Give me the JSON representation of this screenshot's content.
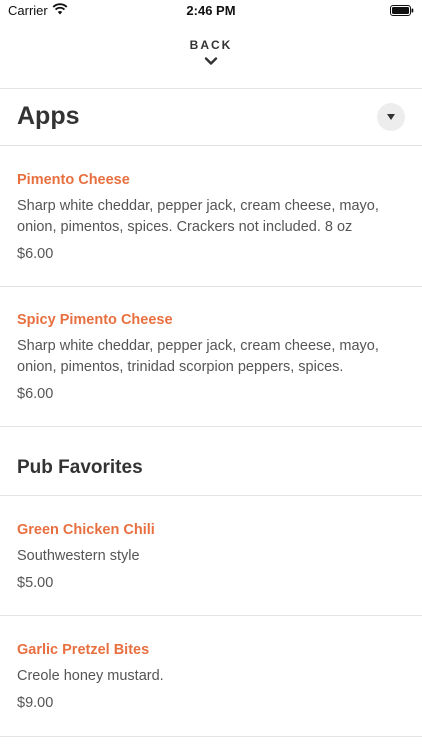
{
  "status_bar": {
    "carrier": "Carrier",
    "time": "2:46 PM"
  },
  "nav": {
    "back_label": "BACK"
  },
  "sections": [
    {
      "title": "Apps",
      "items": [
        {
          "name": "Pimento Cheese",
          "description": "Sharp white cheddar, pepper jack, cream cheese, mayo, onion, pimentos, spices.  Crackers not included.  8 oz",
          "price": "$6.00"
        },
        {
          "name": "Spicy Pimento Cheese",
          "description": "Sharp white cheddar, pepper jack, cream cheese, mayo, onion, pimentos, trinidad scorpion peppers, spices.",
          "price": "$6.00"
        }
      ]
    },
    {
      "title": "Pub Favorites",
      "items": [
        {
          "name": "Green Chicken Chili",
          "description": "Southwestern style",
          "price": "$5.00"
        },
        {
          "name": "Garlic Pretzel Bites",
          "description": "Creole honey mustard.",
          "price": "$9.00"
        }
      ]
    }
  ],
  "colors": {
    "accent": "#e87040",
    "text": "#333333",
    "muted": "#555555",
    "divider": "#e3e3e3"
  }
}
